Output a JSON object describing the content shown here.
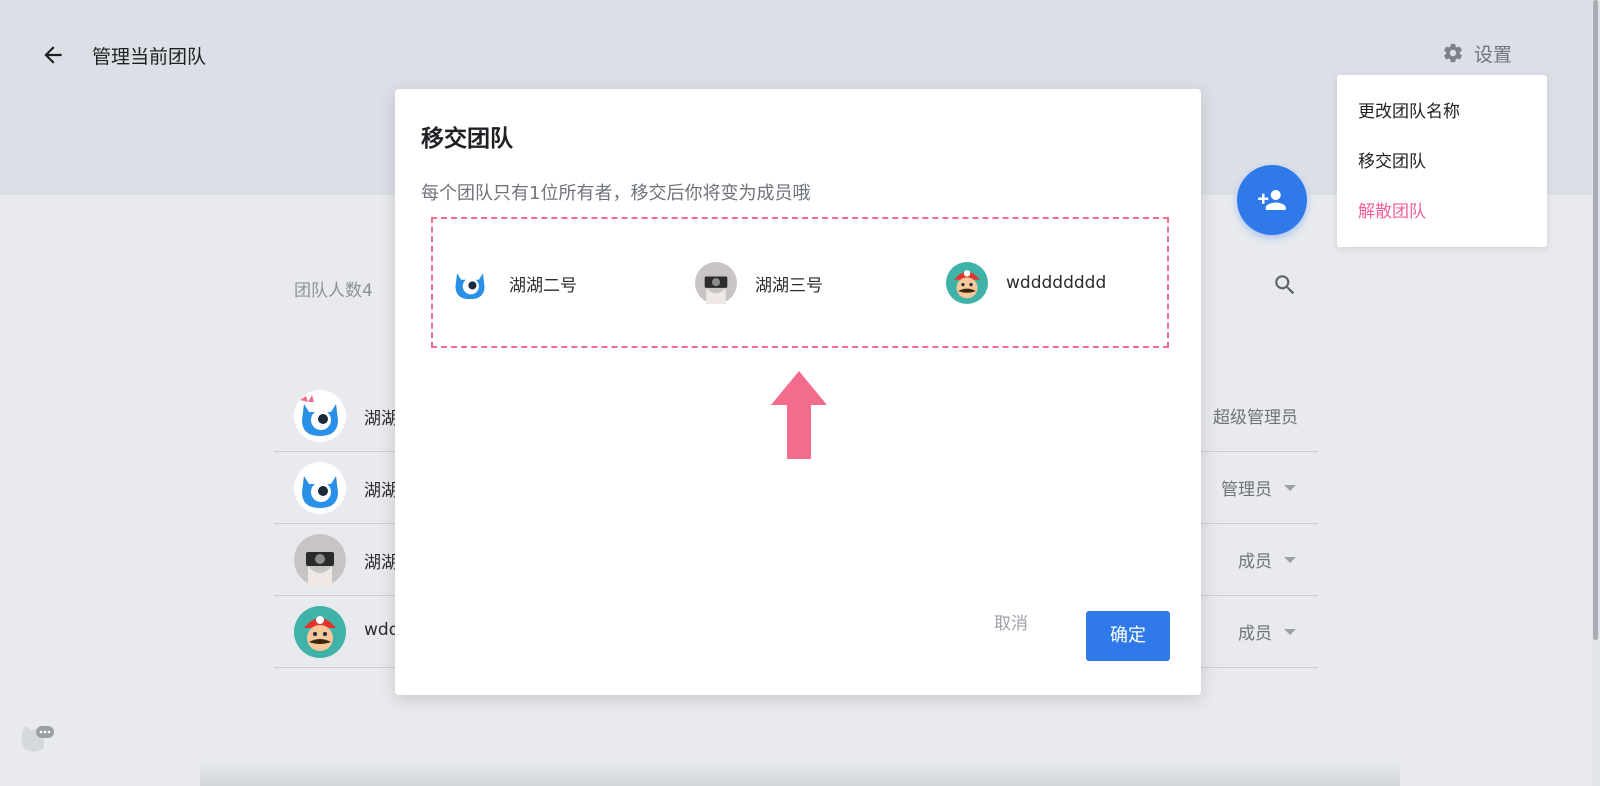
{
  "header": {
    "title": "管理当前团队",
    "settings_label": "设置"
  },
  "settings_menu": {
    "items": [
      {
        "label": "更改团队名称"
      },
      {
        "label": "移交团队"
      },
      {
        "label": "解散团队"
      }
    ]
  },
  "team": {
    "count_label": "团队人数4",
    "members": [
      {
        "name": "湖湖",
        "role": "超级管理员",
        "avatar": "blue-monster-bow-avatar"
      },
      {
        "name": "湖湖",
        "role": "管理员",
        "avatar": "blue-monster-avatar"
      },
      {
        "name": "湖湖",
        "role": "成员",
        "avatar": "camera-photo-avatar"
      },
      {
        "name": "wdd",
        "role": "成员",
        "avatar": "mario-avatar"
      }
    ]
  },
  "modal": {
    "title": "移交团队",
    "description": "每个团队只有1位所有者，移交后你将变为成员哦",
    "candidates": [
      {
        "name": "湖湖二号",
        "avatar": "blue-monster-avatar"
      },
      {
        "name": "湖湖三号",
        "avatar": "camera-photo-avatar"
      },
      {
        "name": "wdddddddd",
        "avatar": "mario-avatar"
      }
    ],
    "cancel_label": "取消",
    "confirm_label": "确定"
  },
  "colors": {
    "primary": "#2f7ae8",
    "danger": "#f0609a",
    "annotation": "#f36c8d"
  }
}
